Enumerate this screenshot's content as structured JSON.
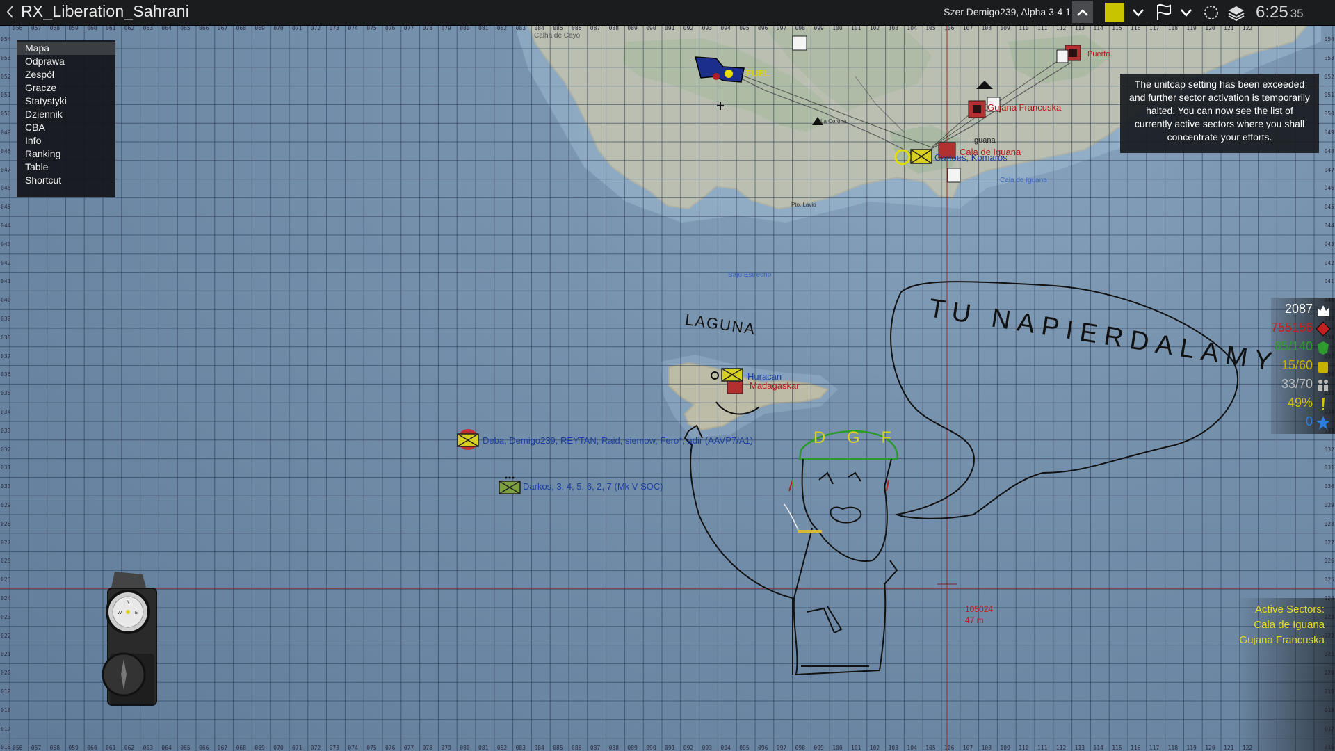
{
  "title": "RX_Liberation_Sahrani",
  "player": "Szer Demigo239, Alpha 3-4 1",
  "clock": {
    "time": "6:25",
    "seconds": "35"
  },
  "accent_color": "#c8c400",
  "menu": {
    "items": [
      {
        "label": "Mapa",
        "active": true
      },
      {
        "label": "Odprawa"
      },
      {
        "label": "Zespół"
      },
      {
        "label": "Gracze"
      },
      {
        "label": "Statystyki"
      },
      {
        "label": "Dziennik"
      },
      {
        "label": "CBA"
      },
      {
        "label": "Info"
      },
      {
        "label": "Ranking"
      },
      {
        "label": "Table"
      },
      {
        "label": "Shortcut"
      }
    ]
  },
  "notice": "The unitcap setting has been exceeded and further sector activation is temporarily halted. You can now see the list of currently active sectors where you shall concentrate your efforts.",
  "stats": [
    {
      "value": "2087",
      "color": "#ffffff",
      "icon": "infantry-icon"
    },
    {
      "value": "755156",
      "color": "#c22020",
      "icon": "supplies-icon"
    },
    {
      "value": "85/140",
      "color": "#2f9a2f",
      "icon": "ammo-icon"
    },
    {
      "value": "15/60",
      "color": "#c8b400",
      "icon": "fuel-icon"
    },
    {
      "value": "33/70",
      "color": "#bdbdbd",
      "icon": "units-icon"
    },
    {
      "value": "49%",
      "color": "#d8c400",
      "icon": "alert-icon"
    },
    {
      "value": "0",
      "color": "#2b7fe0",
      "icon": "star-icon"
    }
  ],
  "sectors": {
    "heading": "Active Sectors:",
    "items": [
      "Cala de Iguana",
      "Gujana Francuska"
    ]
  },
  "map": {
    "places": {
      "calha_de_cayo": "Calha de Cayo",
      "fuel": "FUEL",
      "gujana": "Gujana Francuska",
      "iguana": "Iguana",
      "cala_de_iguana_town": "Cala de Iguana",
      "komaros": "Cartoes, Komaros",
      "cala_de_iguana_water": "Cala de Iguana",
      "la_corona": "La Corona",
      "puerto": "Puerto",
      "bajo_estrecho": "Bajo Estrecho",
      "huracan": "Huracan",
      "madagaskar": "Madagaskar",
      "plato": "Pto. Lavio"
    },
    "squads": {
      "deba": "Deba, Demigo239, REYTAN, Raid, siemow, Fero*, adir (AAVP7/A1)",
      "darkos": "Darkos, 3, 4, 5, 6, 2, 7 (Mk V SOC)"
    },
    "drawings": {
      "laguna": "LAGUNA",
      "speech": "TU NAPIERDALAMY",
      "helmet": "D G F"
    },
    "cursor": {
      "grid": "105024",
      "distance": "47 m"
    }
  },
  "grid_cols": [
    "056",
    "057",
    "058",
    "059",
    "060",
    "061",
    "062",
    "063",
    "064",
    "065",
    "066",
    "067",
    "068",
    "069",
    "070",
    "071",
    "072",
    "073",
    "074",
    "075",
    "076",
    "077",
    "078",
    "079",
    "080",
    "081",
    "082",
    "083",
    "084",
    "085",
    "086",
    "087",
    "088",
    "089",
    "090",
    "091",
    "092",
    "093",
    "094",
    "095",
    "096",
    "097",
    "098",
    "099",
    "100",
    "101",
    "102",
    "103",
    "104",
    "105",
    "106",
    "107",
    "108",
    "109",
    "110",
    "111",
    "112",
    "113",
    "114",
    "115",
    "116",
    "117",
    "118",
    "119",
    "120",
    "121",
    "122"
  ],
  "grid_rows": [
    "054",
    "053",
    "052",
    "051",
    "050",
    "049",
    "048",
    "047",
    "046",
    "045",
    "044",
    "043",
    "042",
    "041",
    "040",
    "039",
    "038",
    "037",
    "036",
    "035",
    "034",
    "033",
    "032",
    "031",
    "030",
    "029",
    "028",
    "027",
    "026",
    "025",
    "024",
    "023",
    "022",
    "021",
    "020",
    "019",
    "018",
    "017",
    "016"
  ]
}
